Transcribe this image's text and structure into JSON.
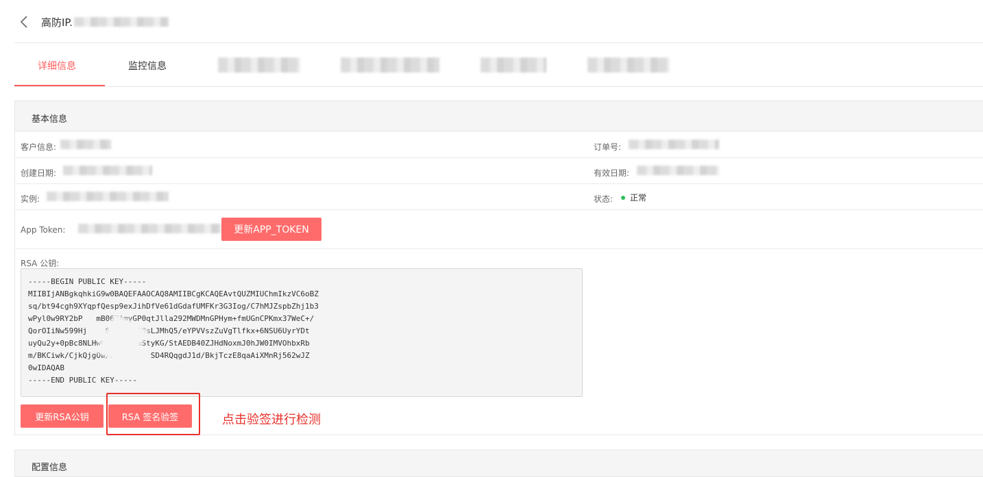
{
  "header": {
    "title": "高防IP."
  },
  "tabs": [
    {
      "label": "详细信息",
      "active": true
    },
    {
      "label": "监控信息",
      "active": false
    }
  ],
  "basic": {
    "section_title": "基本信息",
    "customer_label": "客户信息:",
    "order_label": "订单号:",
    "created_label": "创建日期:",
    "expire_label": "有效日期:",
    "instance_label": "实例:",
    "status_label": "状态:",
    "status_value": "正常",
    "token_label": "App Token:",
    "update_token_button": "更新APP_TOKEN",
    "rsa_label": "RSA 公钥:",
    "rsa_key": "-----BEGIN PUBLIC KEY-----\nMIIBIjANBgkqhkiG9w0BAQEFAAOCAQ8AMIIBCgKCAQEAvtQUZMIUChmIkzVC6oBZ\nsq/bt94cgh9XYqpfQesp9exJihDfVe61dGdafUMFKr3G3Iog/C7hMJZspbZhj1b3\nwPyl0w9RY2bP   mB06ZAmyGP0qtJlla292MWDMnGPHym+fmUGnCPKmx37WeC+/\nQorOIiNw599Hj    SCN6IJND8sLJMhQ5/eYPVVszZuVgTlfkx+6NSU6UyrYDt\nuyQu2y+0pBc8NLHwk/   tlUaStyKG/StAEDB40ZJHdNoxmJ0hJW0IMVOhbxRb\nm/BKCiwk/CjkQjgOw/Bc       SD4RQqgdJ1d/BkjTczE8qaAiXMnRj562wJZ\n0wIDAQAB\n-----END PUBLIC KEY-----",
    "update_rsa_button": "更新RSA公钥",
    "rsa_verify_button": "RSA 签名验签",
    "annotation": "点击验签进行检测"
  },
  "config": {
    "section_title": "配置信息"
  },
  "colors": {
    "accent": "#ff6b6b",
    "annotation": "#e8302b",
    "status_ok": "#2fbf5a"
  }
}
